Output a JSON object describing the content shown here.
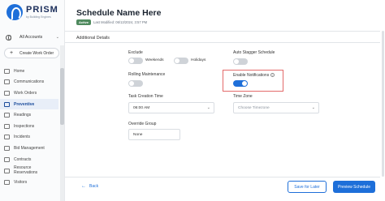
{
  "brand": {
    "name": "PRISM",
    "tagline": "by Building Engines"
  },
  "sidebar": {
    "account_label": "All Accounts",
    "create_button": "Create Work Order",
    "items": [
      {
        "label": "Home",
        "active": false
      },
      {
        "label": "Communications",
        "active": false
      },
      {
        "label": "Work Orders",
        "active": false
      },
      {
        "label": "Preventive",
        "active": true
      },
      {
        "label": "Readings",
        "active": false
      },
      {
        "label": "Inspections",
        "active": false
      },
      {
        "label": "Incidents",
        "active": false
      },
      {
        "label": "Bid Management",
        "active": false
      },
      {
        "label": "Contracts",
        "active": false
      },
      {
        "label": "Resource Reservations",
        "active": false
      },
      {
        "label": "Visitors",
        "active": false
      }
    ]
  },
  "header": {
    "title": "Schedule Name Here",
    "status": "Active",
    "last_modified": "Last Modified: 06/13/2024, 3:57 PM"
  },
  "section": {
    "title": "Additional Details"
  },
  "form": {
    "exclude": {
      "label": "Exclude",
      "weekends": "Weekends",
      "holidays": "Holidays",
      "weekends_on": false,
      "holidays_on": false
    },
    "auto_stagger": {
      "label": "Auto Stagger Schedule",
      "on": false
    },
    "rolling_maintenance": {
      "label": "Rolling Maintenance",
      "on": false
    },
    "enable_notifications": {
      "label": "Enable Notifications",
      "on": true
    },
    "task_creation_time": {
      "label": "Task Creation Time",
      "value": "06:00 AM"
    },
    "time_zone": {
      "label": "Time Zone",
      "placeholder": "Choose Timezone"
    },
    "override_group": {
      "label": "Override Group",
      "value": "None"
    }
  },
  "footer": {
    "back": "Back",
    "save_later": "Save for Later",
    "preview": "Preview Schedule"
  },
  "colors": {
    "accent": "#1e6fd9",
    "highlight": "#e36a6a",
    "status": "#4f8a5e"
  }
}
